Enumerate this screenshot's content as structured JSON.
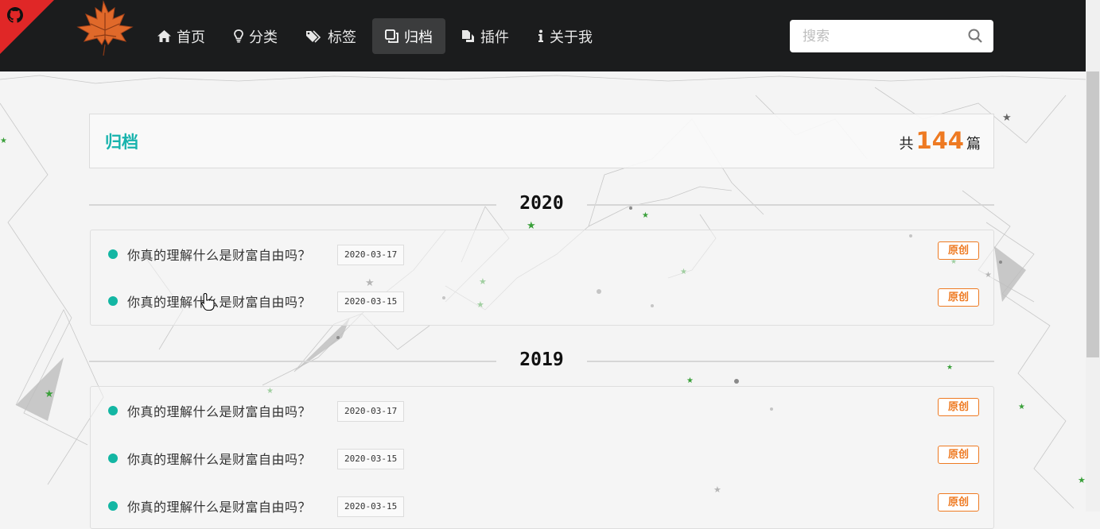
{
  "brand": {
    "colors": {
      "accent": "#17b3ad",
      "count": "#ee7a22",
      "navbar": "#1b1c1d",
      "corner": "#e02727"
    }
  },
  "github_corner": {
    "icon": "github-icon"
  },
  "nav": {
    "items": [
      {
        "label": "首页",
        "icon": "home-icon"
      },
      {
        "label": "分类",
        "icon": "lightbulb-icon"
      },
      {
        "label": "标签",
        "icon": "tags-icon"
      },
      {
        "label": "归档",
        "icon": "copy-icon",
        "active": true
      },
      {
        "label": "插件",
        "icon": "files-icon"
      },
      {
        "label": "关于我",
        "icon": "info-icon"
      }
    ]
  },
  "search": {
    "placeholder": "搜索",
    "value": ""
  },
  "archive": {
    "title": "归档",
    "count_prefix": "共",
    "count": "144",
    "count_suffix": "篇"
  },
  "years": [
    {
      "year": "2020",
      "posts": [
        {
          "title": "你真的理解什么是财富自由吗？",
          "date": "2020-03-17",
          "badge": "原创"
        },
        {
          "title": "你真的理解什么是财富自由吗？",
          "date": "2020-03-15",
          "badge": "原创"
        }
      ]
    },
    {
      "year": "2019",
      "posts": [
        {
          "title": "你真的理解什么是财富自由吗？",
          "date": "2020-03-17",
          "badge": "原创"
        },
        {
          "title": "你真的理解什么是财富自由吗？",
          "date": "2020-03-15",
          "badge": "原创"
        },
        {
          "title": "你真的理解什么是财富自由吗？",
          "date": "2020-03-15",
          "badge": "原创"
        }
      ]
    }
  ]
}
